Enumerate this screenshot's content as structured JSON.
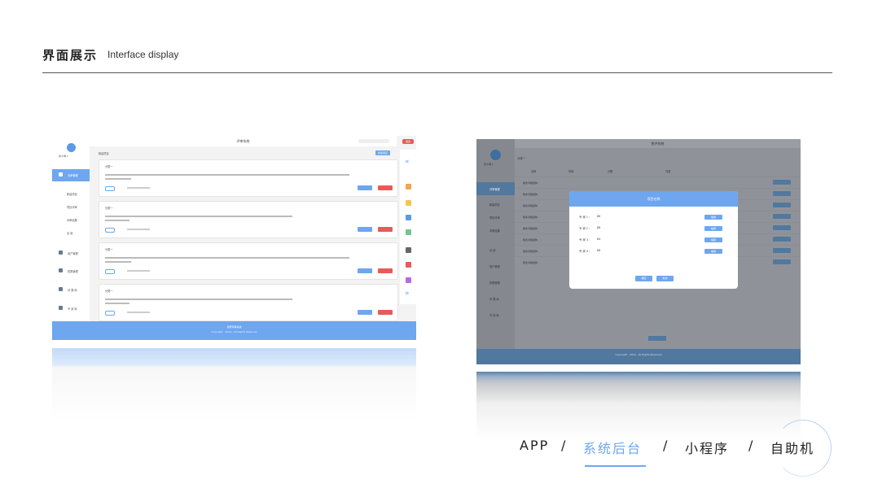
{
  "header": {
    "title_cn": "界面展示",
    "title_en": "Interface display"
  },
  "left_screen": {
    "user_name": "张小明 ▾",
    "sidebar_items": [
      {
        "label": "评审管理",
        "active": true
      },
      {
        "label": "新建项目",
        "sub": true
      },
      {
        "label": "项目评审",
        "sub": true
      },
      {
        "label": "评审结果",
        "sub": true
      },
      {
        "label": "全 部",
        "sub": true
      },
      {
        "label": "用户管理"
      },
      {
        "label": "权限管理"
      },
      {
        "label": "评 委 库"
      },
      {
        "label": "专 家 库"
      }
    ],
    "top_title": "评审系统",
    "exit_label": "退出",
    "section_title": "新建项目",
    "add_button": "新建项目",
    "cards": [
      {
        "title": "分类一"
      },
      {
        "title": "分类一"
      },
      {
        "title": "分类一"
      },
      {
        "title": "分类一"
      }
    ],
    "footer_line1": "智能评审系统",
    "footer_line2": "Copyright · 2019 · All Rights Reserved"
  },
  "right_screen": {
    "user_name": "张小明 ▾",
    "top_title": "税评系统",
    "section_title": "分类一",
    "table_headers": [
      "名称",
      "时间",
      "分数",
      "评语"
    ],
    "rows": [
      "税务清税结构",
      "税务清税结构",
      "税务清税结构",
      "税务清税结构",
      "税务清税结构",
      "税务清税结构",
      "税务清税结构",
      "税务清税结构"
    ],
    "sidebar_items": [
      {
        "label": "评审管理",
        "active": true
      },
      {
        "label": "新建项目"
      },
      {
        "label": "项目评审"
      },
      {
        "label": "评审结果"
      },
      {
        "label": "全 部"
      },
      {
        "label": "用户管理"
      },
      {
        "label": "权限管理"
      },
      {
        "label": "评 委 库"
      },
      {
        "label": "专 家 库"
      }
    ],
    "modal": {
      "title": "项目名称",
      "rows": [
        {
          "label": "专 家 1 :",
          "value": "86",
          "button": "编辑"
        },
        {
          "label": "专 家 2 :",
          "value": "86",
          "button": "编辑"
        },
        {
          "label": "专 家 3 :",
          "value": "84",
          "button": "编辑"
        },
        {
          "label": "专 家 4 :",
          "value": "86",
          "button": "编辑"
        }
      ],
      "ok": "确定",
      "cancel": "取消"
    }
  },
  "nav": {
    "items": [
      "APP",
      "/",
      "系统后台",
      "/",
      "小程序",
      "/",
      "自助机"
    ],
    "active_index": 2
  },
  "colors": {
    "accent": "#6ea6ef",
    "danger": "#e85a5a",
    "dark_overlay": "#8f9399"
  }
}
